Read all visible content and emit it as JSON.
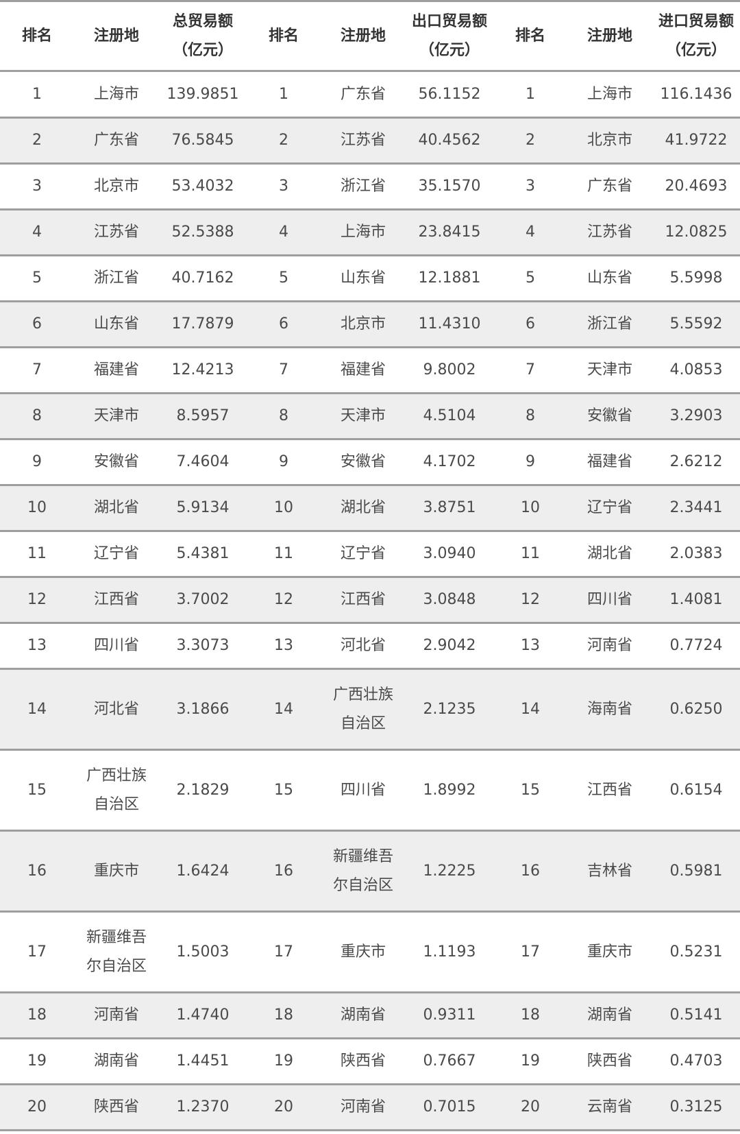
{
  "header": {
    "rank": "排名",
    "region": "注册地",
    "total": [
      "总贸易额",
      "（亿元）"
    ],
    "export": [
      "出口贸易额",
      "（亿元）"
    ],
    "import": [
      "进口贸易额",
      "（亿元）"
    ]
  },
  "rows": [
    {
      "t_rank": "1",
      "t_name": [
        "上海市"
      ],
      "t_val": "139.9851",
      "e_rank": "1",
      "e_name": [
        "广东省"
      ],
      "e_val": "56.1152",
      "i_rank": "1",
      "i_name": [
        "上海市"
      ],
      "i_val": "116.1436"
    },
    {
      "t_rank": "2",
      "t_name": [
        "广东省"
      ],
      "t_val": "76.5845",
      "e_rank": "2",
      "e_name": [
        "江苏省"
      ],
      "e_val": "40.4562",
      "i_rank": "2",
      "i_name": [
        "北京市"
      ],
      "i_val": "41.9722"
    },
    {
      "t_rank": "3",
      "t_name": [
        "北京市"
      ],
      "t_val": "53.4032",
      "e_rank": "3",
      "e_name": [
        "浙江省"
      ],
      "e_val": "35.1570",
      "i_rank": "3",
      "i_name": [
        "广东省"
      ],
      "i_val": "20.4693"
    },
    {
      "t_rank": "4",
      "t_name": [
        "江苏省"
      ],
      "t_val": "52.5388",
      "e_rank": "4",
      "e_name": [
        "上海市"
      ],
      "e_val": "23.8415",
      "i_rank": "4",
      "i_name": [
        "江苏省"
      ],
      "i_val": "12.0825"
    },
    {
      "t_rank": "5",
      "t_name": [
        "浙江省"
      ],
      "t_val": "40.7162",
      "e_rank": "5",
      "e_name": [
        "山东省"
      ],
      "e_val": "12.1881",
      "i_rank": "5",
      "i_name": [
        "山东省"
      ],
      "i_val": "5.5998"
    },
    {
      "t_rank": "6",
      "t_name": [
        "山东省"
      ],
      "t_val": "17.7879",
      "e_rank": "6",
      "e_name": [
        "北京市"
      ],
      "e_val": "11.4310",
      "i_rank": "6",
      "i_name": [
        "浙江省"
      ],
      "i_val": "5.5592"
    },
    {
      "t_rank": "7",
      "t_name": [
        "福建省"
      ],
      "t_val": "12.4213",
      "e_rank": "7",
      "e_name": [
        "福建省"
      ],
      "e_val": "9.8002",
      "i_rank": "7",
      "i_name": [
        "天津市"
      ],
      "i_val": "4.0853"
    },
    {
      "t_rank": "8",
      "t_name": [
        "天津市"
      ],
      "t_val": "8.5957",
      "e_rank": "8",
      "e_name": [
        "天津市"
      ],
      "e_val": "4.5104",
      "i_rank": "8",
      "i_name": [
        "安徽省"
      ],
      "i_val": "3.2903"
    },
    {
      "t_rank": "9",
      "t_name": [
        "安徽省"
      ],
      "t_val": "7.4604",
      "e_rank": "9",
      "e_name": [
        "安徽省"
      ],
      "e_val": "4.1702",
      "i_rank": "9",
      "i_name": [
        "福建省"
      ],
      "i_val": "2.6212"
    },
    {
      "t_rank": "10",
      "t_name": [
        "湖北省"
      ],
      "t_val": "5.9134",
      "e_rank": "10",
      "e_name": [
        "湖北省"
      ],
      "e_val": "3.8751",
      "i_rank": "10",
      "i_name": [
        "辽宁省"
      ],
      "i_val": "2.3441"
    },
    {
      "t_rank": "11",
      "t_name": [
        "辽宁省"
      ],
      "t_val": "5.4381",
      "e_rank": "11",
      "e_name": [
        "辽宁省"
      ],
      "e_val": "3.0940",
      "i_rank": "11",
      "i_name": [
        "湖北省"
      ],
      "i_val": "2.0383"
    },
    {
      "t_rank": "12",
      "t_name": [
        "江西省"
      ],
      "t_val": "3.7002",
      "e_rank": "12",
      "e_name": [
        "江西省"
      ],
      "e_val": "3.0848",
      "i_rank": "12",
      "i_name": [
        "四川省"
      ],
      "i_val": "1.4081"
    },
    {
      "t_rank": "13",
      "t_name": [
        "四川省"
      ],
      "t_val": "3.3073",
      "e_rank": "13",
      "e_name": [
        "河北省"
      ],
      "e_val": "2.9042",
      "i_rank": "13",
      "i_name": [
        "河南省"
      ],
      "i_val": "0.7724"
    },
    {
      "t_rank": "14",
      "t_name": [
        "河北省"
      ],
      "t_val": "3.1866",
      "e_rank": "14",
      "e_name": [
        "广西壮族",
        "自治区"
      ],
      "e_val": "2.1235",
      "i_rank": "14",
      "i_name": [
        "海南省"
      ],
      "i_val": "0.6250"
    },
    {
      "t_rank": "15",
      "t_name": [
        "广西壮族",
        "自治区"
      ],
      "t_val": "2.1829",
      "e_rank": "15",
      "e_name": [
        "四川省"
      ],
      "e_val": "1.8992",
      "i_rank": "15",
      "i_name": [
        "江西省"
      ],
      "i_val": "0.6154"
    },
    {
      "t_rank": "16",
      "t_name": [
        "重庆市"
      ],
      "t_val": "1.6424",
      "e_rank": "16",
      "e_name": [
        "新疆维吾",
        "尔自治区"
      ],
      "e_val": "1.2225",
      "i_rank": "16",
      "i_name": [
        "吉林省"
      ],
      "i_val": "0.5981"
    },
    {
      "t_rank": "17",
      "t_name": [
        "新疆维吾",
        "尔自治区"
      ],
      "t_val": "1.5003",
      "e_rank": "17",
      "e_name": [
        "重庆市"
      ],
      "e_val": "1.1193",
      "i_rank": "17",
      "i_name": [
        "重庆市"
      ],
      "i_val": "0.5231"
    },
    {
      "t_rank": "18",
      "t_name": [
        "河南省"
      ],
      "t_val": "1.4740",
      "e_rank": "18",
      "e_name": [
        "湖南省"
      ],
      "e_val": "0.9311",
      "i_rank": "18",
      "i_name": [
        "湖南省"
      ],
      "i_val": "0.5141"
    },
    {
      "t_rank": "19",
      "t_name": [
        "湖南省"
      ],
      "t_val": "1.4451",
      "e_rank": "19",
      "e_name": [
        "陕西省"
      ],
      "e_val": "0.7667",
      "i_rank": "19",
      "i_name": [
        "陕西省"
      ],
      "i_val": "0.4703"
    },
    {
      "t_rank": "20",
      "t_name": [
        "陕西省"
      ],
      "t_val": "1.2370",
      "e_rank": "20",
      "e_name": [
        "河南省"
      ],
      "e_val": "0.7015",
      "i_rank": "20",
      "i_name": [
        "云南省"
      ],
      "i_val": "0.3125"
    }
  ]
}
